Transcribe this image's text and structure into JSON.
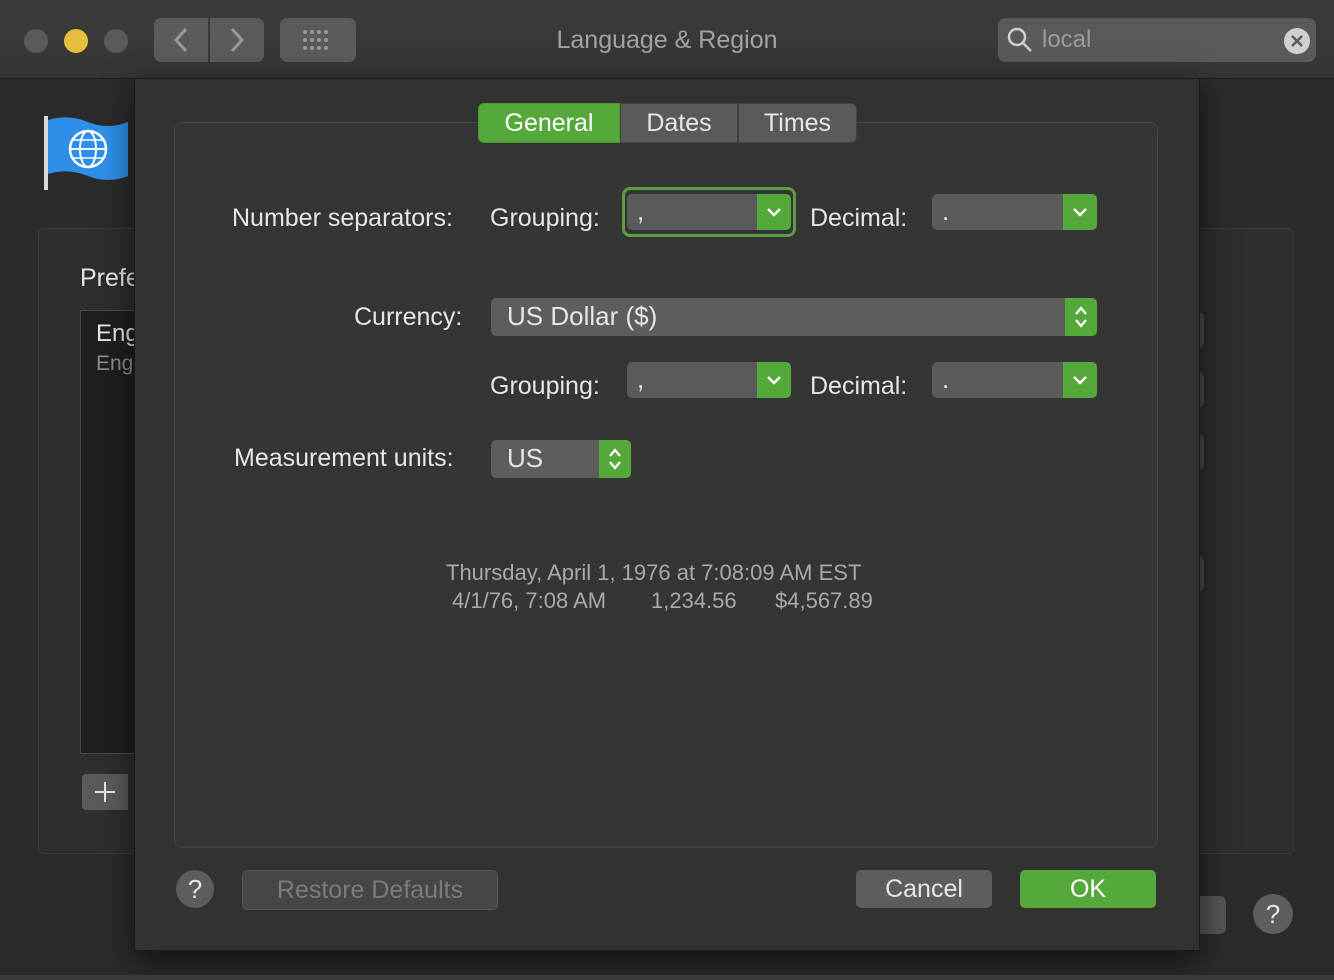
{
  "window": {
    "title": "Language & Region",
    "search": {
      "value": "local"
    }
  },
  "background": {
    "preferred_label": "Prefe",
    "languages": [
      {
        "primary": "Eng",
        "secondary": "Eng"
      }
    ],
    "add_label": "+",
    "help_label": "?"
  },
  "tabs": [
    {
      "label": "General",
      "selected": true
    },
    {
      "label": "Dates",
      "selected": false
    },
    {
      "label": "Times",
      "selected": false
    }
  ],
  "general": {
    "number_separators_label": "Number separators:",
    "grouping_label": "Grouping:",
    "decimal_label": "Decimal:",
    "number_grouping_value": ",",
    "number_decimal_value": ".",
    "currency_label": "Currency:",
    "currency_value": "US Dollar ($)",
    "currency_grouping_value": ",",
    "currency_decimal_value": ".",
    "measurement_label": "Measurement units:",
    "measurement_value": "US",
    "sample_line1": "Thursday, April 1, 1976 at 7:08:09 AM EST",
    "sample_date_short": "4/1/76, 7:08 AM",
    "sample_number": "1,234.56",
    "sample_currency": "$4,567.89"
  },
  "buttons": {
    "help": "?",
    "restore_defaults": "Restore Defaults",
    "cancel": "Cancel",
    "ok": "OK"
  },
  "colors": {
    "accent": "#55a93a",
    "minimize": "#e5bf3c",
    "background": "#2b2b2b"
  }
}
